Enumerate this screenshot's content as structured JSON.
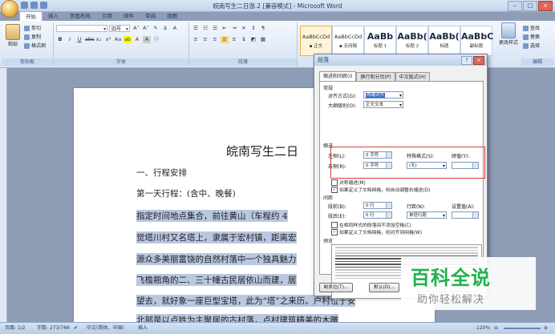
{
  "window": {
    "title": "皖南写生二日游.2 [兼容模式] - Microsoft Word"
  },
  "tabs": [
    "开始",
    "插入",
    "页面布局",
    "引用",
    "邮件",
    "审阅",
    "视图"
  ],
  "ribbon": {
    "clipboard": {
      "paste": "粘贴",
      "cut": "剪切",
      "copy": "复制",
      "format_painter": "格式刷",
      "label": "剪贴板"
    },
    "font": {
      "name": "",
      "size": "四号",
      "label": "字体"
    },
    "paragraph": {
      "label": "段落"
    },
    "styles": {
      "items": [
        {
          "sample": "AaBbCcDd",
          "name": "▪ 正文"
        },
        {
          "sample": "AaBbCcDd",
          "name": "▪ 无间隔"
        },
        {
          "sample": "AaBb",
          "name": "标题 1"
        },
        {
          "sample": "AaBb(",
          "name": "标题 2"
        },
        {
          "sample": "AaBb(",
          "name": "标题"
        },
        {
          "sample": "AaBbC",
          "name": "副标题"
        }
      ],
      "change_styles": "更改样式"
    },
    "editing": {
      "find": "查找",
      "replace": "替换",
      "select": "选择",
      "label": "编辑"
    }
  },
  "document": {
    "title": "皖南写生二日",
    "lines": [
      "一、行程安排",
      "第一天行程：(含中、晚餐)",
      "指定时间地点集合，前往黄山（车程约 4",
      "觉塔川村又名塔上，隶属于宏村镇，距离宏",
      "源众多美丽富饶的自然村落中一个独具魅力",
      "飞檐翘角的二、三十幢古民居依山而建，居",
      "望去，就好象一座巨型宝塔，此为“塔”之来历。户村位于安",
      "北部是以卢姓为主聚居的古村落，卢村建筑精美的木雕"
    ]
  },
  "dialog": {
    "title": "段落",
    "help": "?",
    "close": "×",
    "tabs": [
      "缩进和间距(I)",
      "换行和分页(P)",
      "中文版式(H)"
    ],
    "general": {
      "label": "常规",
      "alignment_label": "对齐方式(G):",
      "alignment_value": "两端对齐",
      "outline_label": "大纲级别(O):",
      "outline_value": "正文文本"
    },
    "indent": {
      "label": "缩进",
      "left_label": "左侧(L):",
      "left_value": "0 字符",
      "right_label": "右侧(R):",
      "right_value": "0 字符",
      "special_label": "特殊格式(S):",
      "special_value": "(无)",
      "by_label": "磅值(Y):",
      "by_value": "",
      "mirror": "对称缩进(M)",
      "auto_adjust": "如果定义了文档网格，则自动调整右缩进(D)"
    },
    "spacing": {
      "label": "间距",
      "before_label": "段前(B):",
      "before_value": "0 行",
      "after_label": "段后(E):",
      "after_value": "0 行",
      "line_label": "行距(N):",
      "line_value": "单倍行距",
      "at_label": "设置值(A):",
      "at_value": "",
      "no_space": "在相同样式的段落间不添加空格(C)",
      "snap_grid": "如果定义了文档网格，则对齐到网格(W)"
    },
    "preview_label": "预览",
    "buttons": {
      "tabs": "制表位(T)...",
      "default": "默认(D)...",
      "ok": "确定",
      "cancel": "取消"
    }
  },
  "statusbar": {
    "page": "页面: 1/2",
    "words": "字数: 273/766",
    "language": "中文(简体，中国)",
    "mode": "插入",
    "zoom": "120%"
  },
  "watermark": {
    "brand": "百科全说",
    "tagline": "助你轻松解决"
  }
}
